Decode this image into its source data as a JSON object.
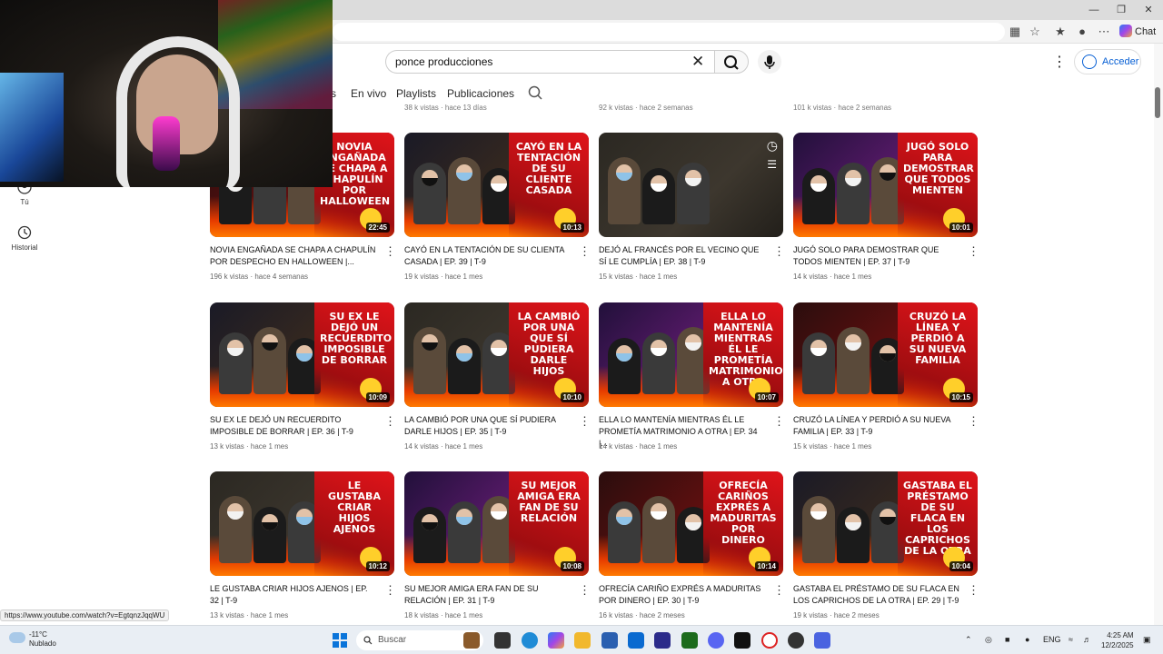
{
  "browser": {
    "chat_label": "Chat"
  },
  "search": {
    "query": "ponce producciones"
  },
  "header": {
    "sign_in_label": "Acceder"
  },
  "tabs": [
    {
      "label": "s"
    },
    {
      "label": "En vivo"
    },
    {
      "label": "Playlists"
    },
    {
      "label": "Publicaciones"
    }
  ],
  "sidebar": {
    "items": [
      {
        "label": "Tú",
        "icon": "account-icon"
      },
      {
        "label": "Historial",
        "icon": "history-icon"
      }
    ]
  },
  "top_row_meta": [
    "38 k vistas · hace 13 días",
    "92 k vistas · hace 2 semanas",
    "101 k vistas · hace 2 semanas"
  ],
  "videos": [
    {
      "title": "NOVIA ENGAÑADA SE CHAPA A CHAPULÍN POR DESPECHO EN HALLOWEEN |...",
      "meta": "196 k vistas · hace 4 semanas",
      "duration": "22:45",
      "banner": "NOVIA ENGAÑADA SE CHAPA A CHAPULÍN POR HALLOWEEN"
    },
    {
      "title": "CAYÓ EN LA TENTACIÓN DE SU CLIENTA CASADA | EP. 39 | T-9",
      "meta": "19 k vistas · hace 1 mes",
      "duration": "10:13",
      "banner": "CAYÓ EN LA TENTACIÓN DE SU CLIENTE CASADA"
    },
    {
      "title": "DEJÓ AL FRANCÉS POR EL VECINO QUE SÍ LE CUMPLÍA | EP. 38 | T-9",
      "meta": "15 k vistas · hace 1 mes",
      "duration": "",
      "banner": ""
    },
    {
      "title": "JUGÓ SOLO PARA DEMOSTRAR QUE TODOS MIENTEN | EP. 37 | T-9",
      "meta": "14 k vistas · hace 1 mes",
      "duration": "10:01",
      "banner": "JUGÓ SOLO PARA DEMOSTRAR QUE TODOS MIENTEN"
    },
    {
      "title": "SU EX LE DEJÓ UN RECUERDITO IMPOSIBLE DE BORRAR | EP. 36 | T-9",
      "meta": "13 k vistas · hace 1 mes",
      "duration": "10:09",
      "banner": "SU EX LE DEJÓ UN RECUERDITO IMPOSIBLE DE BORRAR"
    },
    {
      "title": "LA CAMBIÓ POR UNA QUE SÍ PUDIERA DARLE HIJOS | EP. 35 | T-9",
      "meta": "14 k vistas · hace 1 mes",
      "duration": "10:10",
      "banner": "LA CAMBIÓ POR UNA QUE SÍ PUDIERA DARLE HIJOS"
    },
    {
      "title": "ELLA LO MANTENÍA MIENTRAS ÉL LE PROMETÍA MATRIMONIO A OTRA | EP. 34 |...",
      "meta": "14 k vistas · hace 1 mes",
      "duration": "10:07",
      "banner": "ELLA LO MANTENÍA MIENTRAS ÉL LE PROMETÍA MATRIMONIO A OTRA"
    },
    {
      "title": "CRUZÓ LA LÍNEA Y PERDIÓ A SU NUEVA FAMILIA | EP. 33 | T-9",
      "meta": "15 k vistas · hace 1 mes",
      "duration": "10:15",
      "banner": "CRUZÓ LA LÍNEA Y PERDIÓ A SU NUEVA FAMILIA"
    },
    {
      "title": "LE GUSTABA CRIAR HIJOS AJENOS | EP. 32 | T-9",
      "meta": "13 k vistas · hace 1 mes",
      "duration": "10:12",
      "banner": "LE GUSTABA CRIAR HIJOS AJENOS"
    },
    {
      "title": "SU MEJOR AMIGA ERA FAN DE SU RELACIÓN | EP. 31 | T-9",
      "meta": "18 k vistas · hace 1 mes",
      "duration": "10:08",
      "banner": "SU MEJOR AMIGA ERA FAN DE SU RELACIÓN"
    },
    {
      "title": "OFRECÍA CARIÑO EXPRÉS A MADURITAS POR DINERO | EP. 30 | T-9",
      "meta": "16 k vistas · hace 2 meses",
      "duration": "10:14",
      "banner": "OFRECÍA CARIÑOS EXPRÉS A MADURITAS POR DINERO"
    },
    {
      "title": "GASTABA EL PRÉSTAMO DE SU FLACA EN LOS CAPRICHOS DE LA OTRA | EP. 29 | T-9",
      "meta": "19 k vistas · hace 2 meses",
      "duration": "10:04",
      "banner": "GASTABA EL PRÉSTAMO DE SU FLACA EN LOS CAPRICHOS DE LA OTRA"
    }
  ],
  "status_url": "https://www.youtube.com/watch?v=EgtqnzJqqWU",
  "taskbar": {
    "temperature": "-11°C",
    "weather": "Nublado",
    "search_placeholder": "Buscar",
    "language": "ENG",
    "time": "4:25 AM",
    "date": "12/2/2025"
  },
  "colors": {
    "accent": "#065fd4",
    "banner_red": "#e0141a",
    "fire": "#ff7a00"
  }
}
